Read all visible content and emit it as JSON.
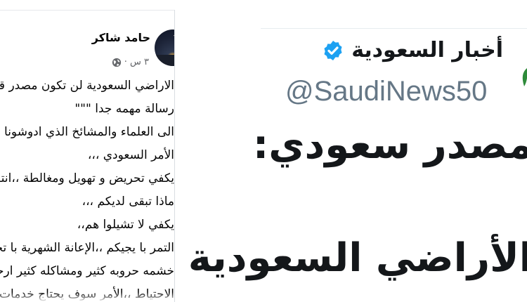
{
  "facebook_post": {
    "author": "حامد شاكر",
    "timestamp": "٣ س ·",
    "privacy_icon": "globe-icon",
    "lines": [
      "الاراضي السعودية لن تكون مصدر قلق",
      "رسالة مهمه جدا \"\"\"",
      "الى العلماء والمشائخ الذي ادوشونا الراي",
      "الأمر السعودي ،،،",
      "يكفي تحريض و تهويل ومغالطة ،،انتو",
      "ماذا تبقى لديكم ،،،",
      "يكفي لا تشيلوا هم،،",
      "التمر با يجيكم ،،الإعانة الشهرية با تجيكم",
      "خشمه حروبه كثير ومشاكله كثير ارحموا",
      "الاحتياط ،،الأمر سوف يحتاج خدمات"
    ]
  },
  "tweet": {
    "display_name": "أخبار السعودية",
    "verified_icon": "verified-badge-icon",
    "handle": "@SaudiNews50",
    "text_line_1": "مصدر سعودي:",
    "text_line_2": "الأراضي السعودية",
    "accent_color": "#1da1f2"
  }
}
